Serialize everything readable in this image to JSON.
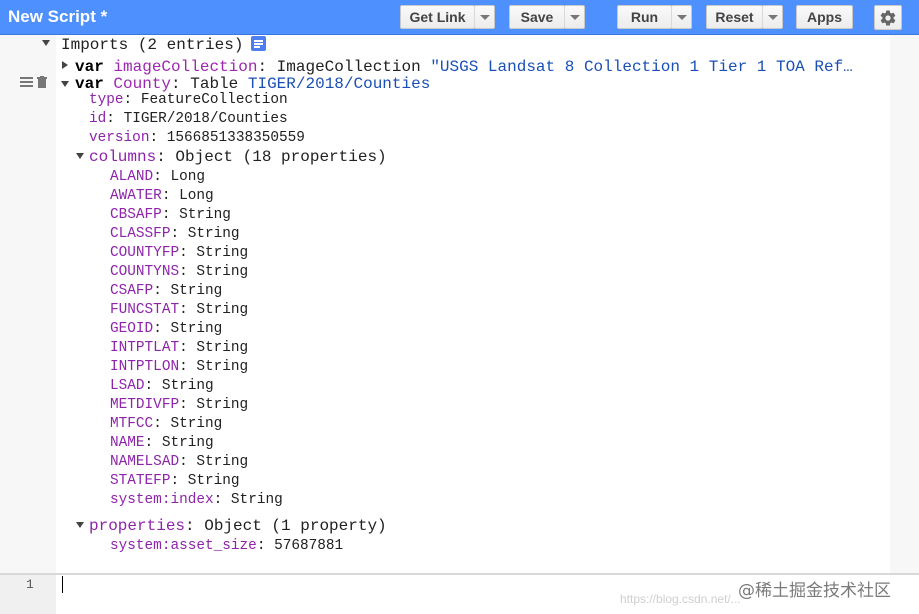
{
  "toolbar": {
    "title": "New Script *",
    "get_link": "Get Link",
    "save": "Save",
    "run": "Run",
    "reset": "Reset",
    "apps": "Apps",
    "settings_icon": "gear-icon"
  },
  "imports": {
    "header": "Imports (2 entries)",
    "icon": "document-icon",
    "row_icons": [
      "drag-handle-icon",
      "trash-icon"
    ],
    "image_collection": {
      "var_kw": "var",
      "name": "imageCollection",
      "type": "ImageCollection",
      "value": "\"USGS Landsat 8 Collection 1 Tier 1 TOA Ref…"
    },
    "county": {
      "var_kw": "var",
      "name": "County",
      "type": "Table",
      "value": "TIGER/2018/Counties",
      "fields": [
        {
          "key": "type",
          "value": "FeatureCollection"
        },
        {
          "key": "id",
          "value": "TIGER/2018/Counties"
        },
        {
          "key": "version",
          "value": "1566851338350559"
        }
      ],
      "columns": {
        "key": "columns",
        "summary": "Object (18 properties)",
        "items": [
          {
            "key": "ALAND",
            "value": "Long"
          },
          {
            "key": "AWATER",
            "value": "Long"
          },
          {
            "key": "CBSAFP",
            "value": "String"
          },
          {
            "key": "CLASSFP",
            "value": "String"
          },
          {
            "key": "COUNTYFP",
            "value": "String"
          },
          {
            "key": "COUNTYNS",
            "value": "String"
          },
          {
            "key": "CSAFP",
            "value": "String"
          },
          {
            "key": "FUNCSTAT",
            "value": "String"
          },
          {
            "key": "GEOID",
            "value": "String"
          },
          {
            "key": "INTPTLAT",
            "value": "String"
          },
          {
            "key": "INTPTLON",
            "value": "String"
          },
          {
            "key": "LSAD",
            "value": "String"
          },
          {
            "key": "METDIVFP",
            "value": "String"
          },
          {
            "key": "MTFCC",
            "value": "String"
          },
          {
            "key": "NAME",
            "value": "String"
          },
          {
            "key": "NAMELSAD",
            "value": "String"
          },
          {
            "key": "STATEFP",
            "value": "String"
          },
          {
            "key": "system:index",
            "value": "String"
          }
        ]
      },
      "properties": {
        "key": "properties",
        "summary": "Object (1 property)",
        "items": [
          {
            "key": "system:asset_size",
            "value": "57687881"
          }
        ]
      }
    }
  },
  "editor": {
    "line_number": "1"
  },
  "watermark": {
    "main": "@稀土掘金技术社区",
    "sub": "https://blog.csdn.net/..."
  },
  "colors": {
    "header_bg": "#4d90fe",
    "keyword": "#000000",
    "identifier": "#9c27b0",
    "string": "#1a4fb5"
  }
}
